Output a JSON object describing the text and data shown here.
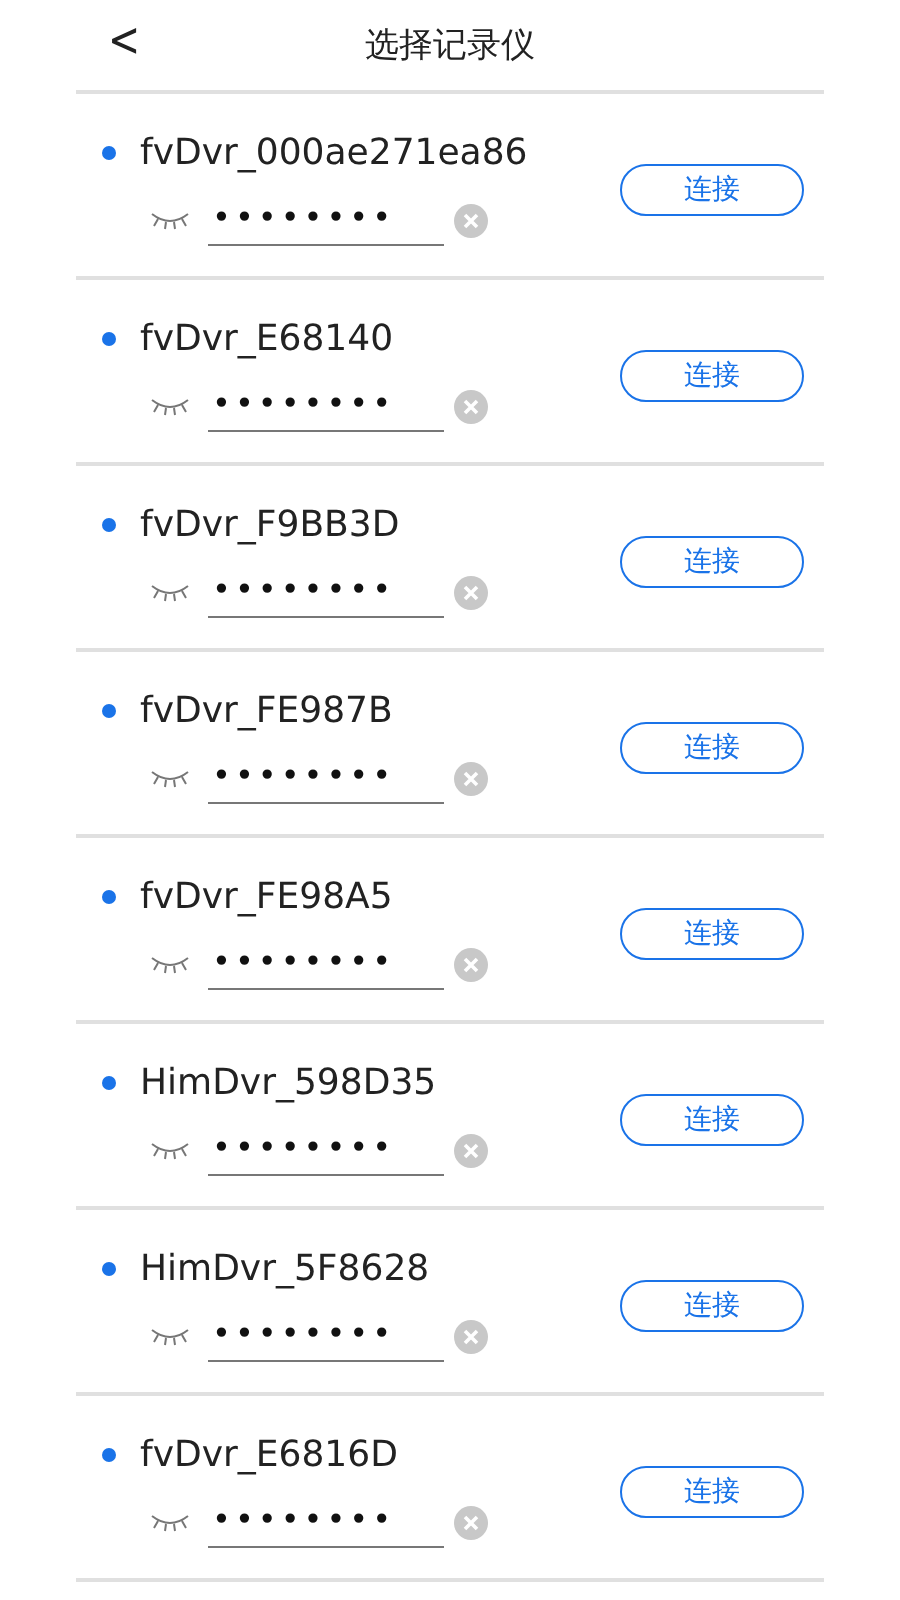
{
  "header": {
    "back": "<",
    "title": "选择记录仪"
  },
  "devices": [
    {
      "name": "fvDvr_000ae271ea86",
      "password": "••••••••",
      "button": "连接"
    },
    {
      "name": "fvDvr_E68140",
      "password": "••••••••",
      "button": "连接"
    },
    {
      "name": "fvDvr_F9BB3D",
      "password": "••••••••",
      "button": "连接"
    },
    {
      "name": "fvDvr_FE987B",
      "password": "••••••••",
      "button": "连接"
    },
    {
      "name": "fvDvr_FE98A5",
      "password": "••••••••",
      "button": "连接"
    },
    {
      "name": "HimDvr_598D35",
      "password": "••••••••",
      "button": "连接"
    },
    {
      "name": "HimDvr_5F8628",
      "password": "••••••••",
      "button": "连接"
    },
    {
      "name": "fvDvr_E6816D",
      "password": "••••••••",
      "button": "连接"
    }
  ]
}
